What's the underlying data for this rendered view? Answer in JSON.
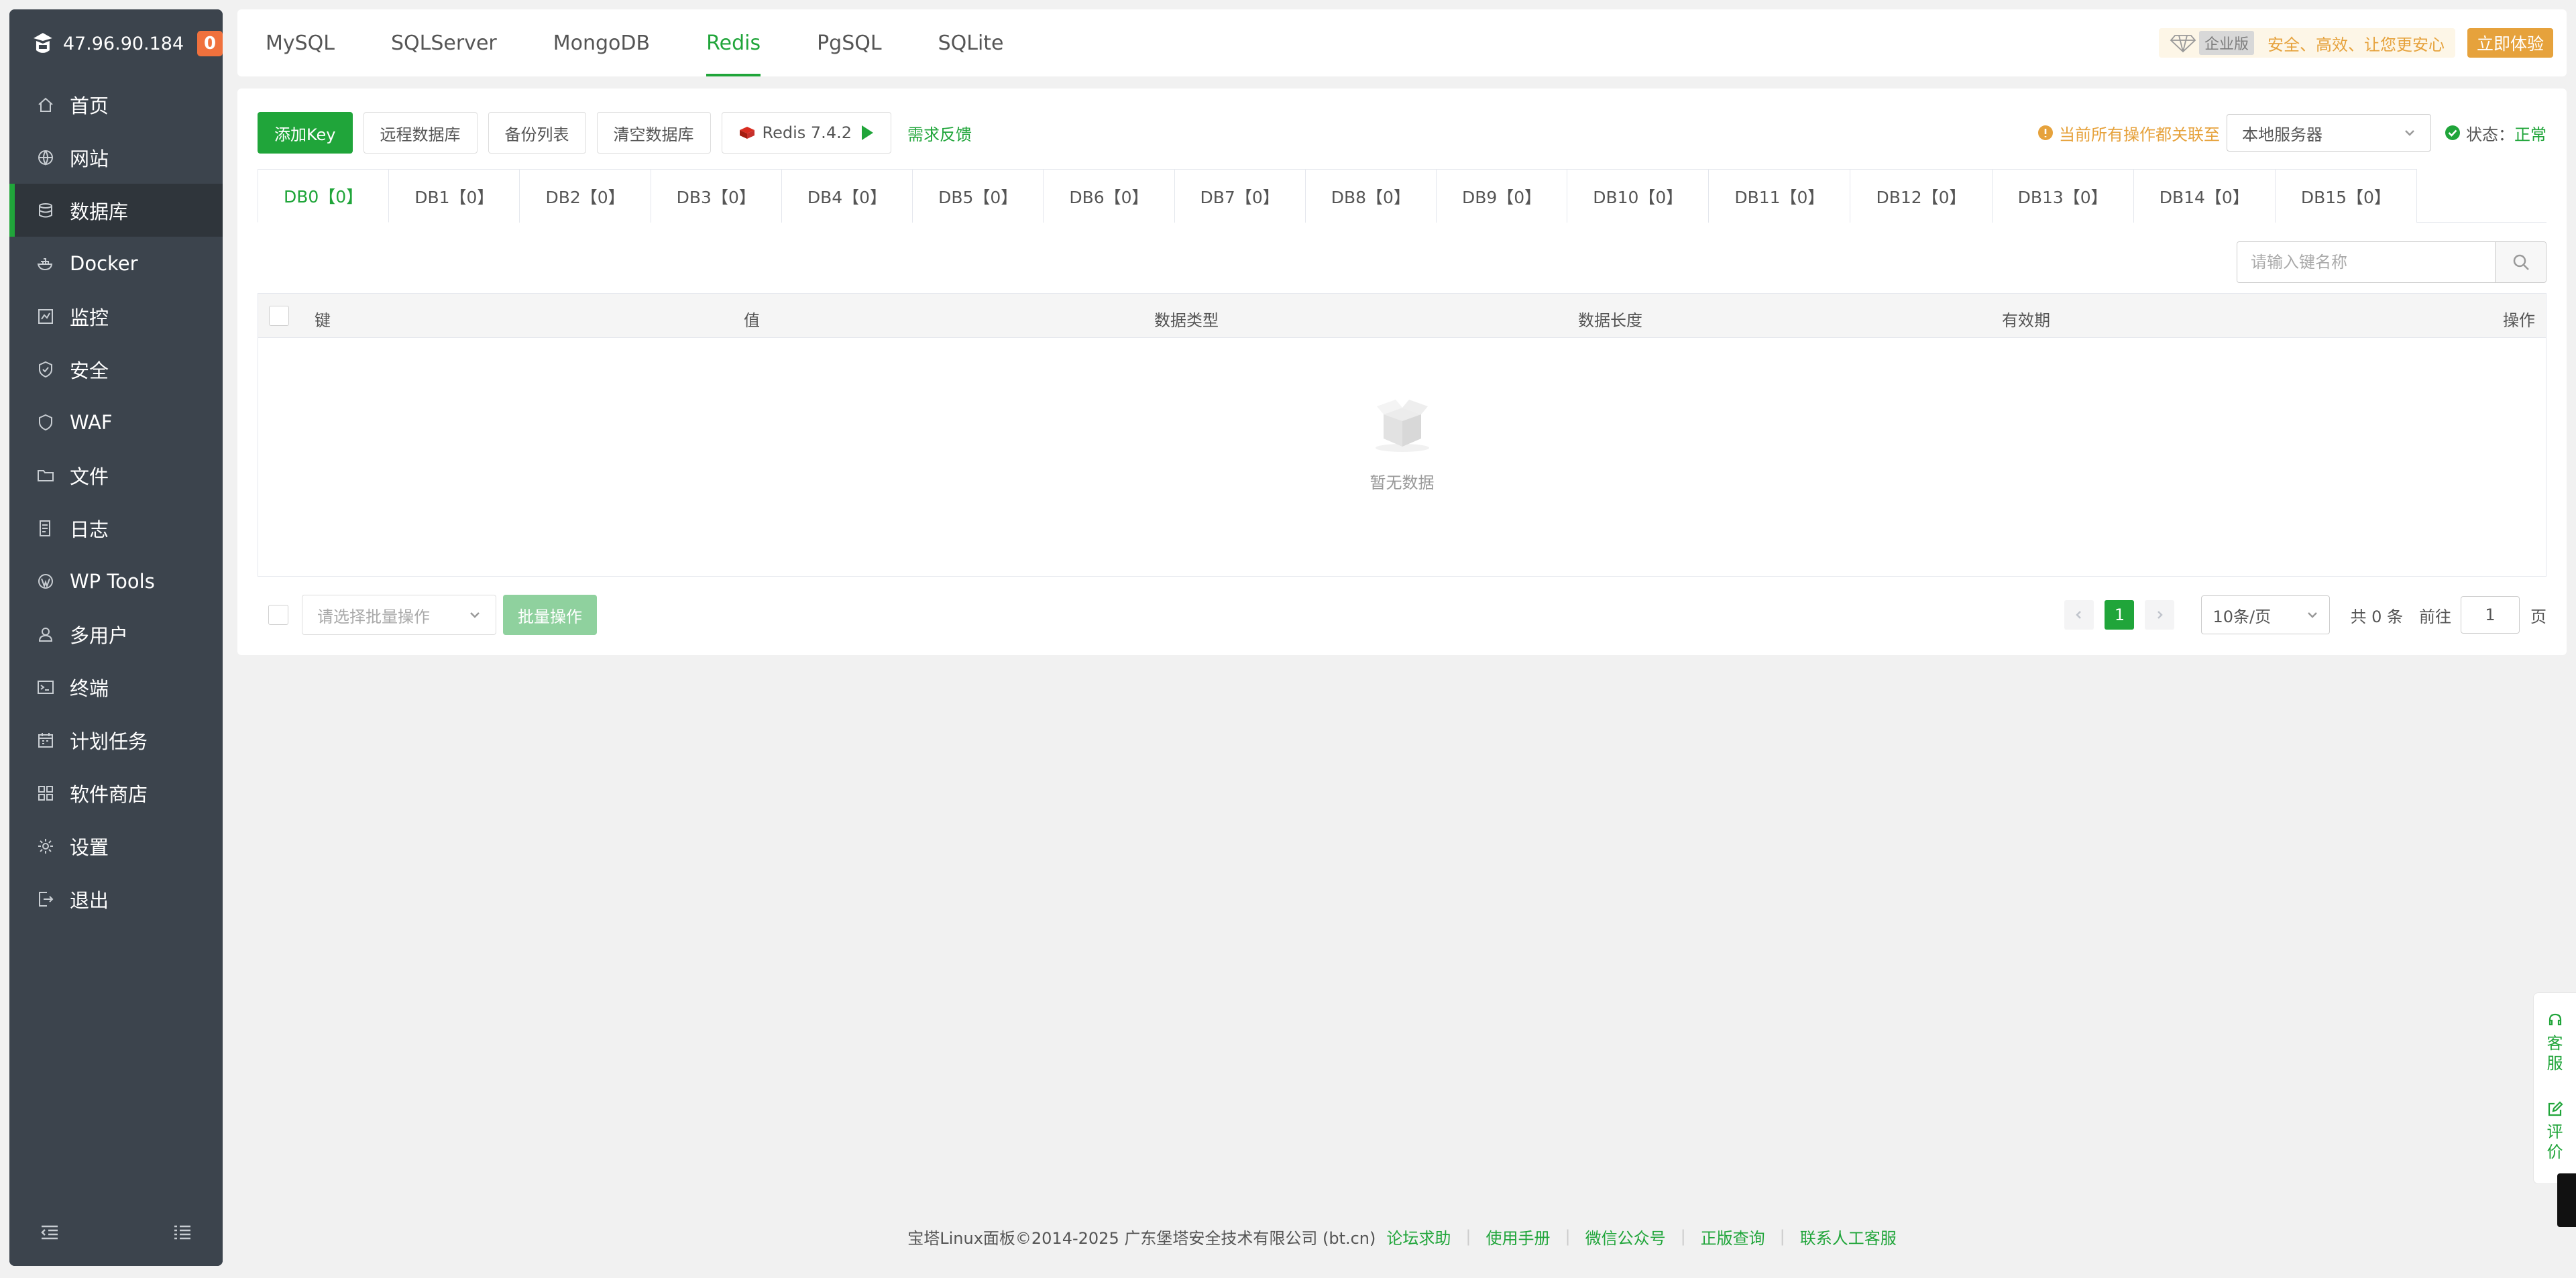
{
  "sidebar": {
    "ip": "47.96.90.184",
    "badge": "0",
    "items": [
      {
        "label": "首页",
        "icon": "home-icon"
      },
      {
        "label": "网站",
        "icon": "globe-icon"
      },
      {
        "label": "数据库",
        "icon": "database-icon"
      },
      {
        "label": "Docker",
        "icon": "docker-icon"
      },
      {
        "label": "监控",
        "icon": "monitor-icon"
      },
      {
        "label": "安全",
        "icon": "shield-icon"
      },
      {
        "label": "WAF",
        "icon": "waf-icon"
      },
      {
        "label": "文件",
        "icon": "folder-icon"
      },
      {
        "label": "日志",
        "icon": "log-icon"
      },
      {
        "label": "WP Tools",
        "icon": "wordpress-icon"
      },
      {
        "label": "多用户",
        "icon": "users-icon"
      },
      {
        "label": "终端",
        "icon": "terminal-icon"
      },
      {
        "label": "计划任务",
        "icon": "calendar-icon"
      },
      {
        "label": "软件商店",
        "icon": "apps-icon"
      },
      {
        "label": "设置",
        "icon": "gear-icon"
      },
      {
        "label": "退出",
        "icon": "logout-icon"
      }
    ],
    "active_index": 2
  },
  "topbar": {
    "tabs": [
      "MySQL",
      "SQLServer",
      "MongoDB",
      "Redis",
      "PgSQL",
      "SQLite"
    ],
    "active_index": 3,
    "promo": {
      "edition": "企业版",
      "slogan": "安全、高效、让您更安心",
      "cta": "立即体验"
    }
  },
  "toolbar": {
    "add_key": "添加Key",
    "remote_db": "远程数据库",
    "backup_list": "备份列表",
    "clear_db": "清空数据库",
    "redis_version": "Redis 7.4.2",
    "feedback": "需求反馈",
    "notice": "当前所有操作都关联至",
    "server": "本地服务器",
    "status_label": "状态：",
    "status_value": "正常"
  },
  "db_tabs": [
    "DB0【0】",
    "DB1【0】",
    "DB2【0】",
    "DB3【0】",
    "DB4【0】",
    "DB5【0】",
    "DB6【0】",
    "DB7【0】",
    "DB8【0】",
    "DB9【0】",
    "DB10【0】",
    "DB11【0】",
    "DB12【0】",
    "DB13【0】",
    "DB14【0】",
    "DB15【0】"
  ],
  "db_active_index": 0,
  "search": {
    "placeholder": "请输入键名称"
  },
  "table": {
    "columns": [
      "键",
      "值",
      "数据类型",
      "数据长度",
      "有效期",
      "操作"
    ],
    "empty_text": "暂无数据"
  },
  "bottom": {
    "batch_placeholder": "请选择批量操作",
    "batch_button": "批量操作",
    "current_page": "1",
    "page_size": "10条/页",
    "total": "共 0 条",
    "goto": "前往",
    "goto_value": "1",
    "page_unit": "页"
  },
  "footer": {
    "copyright": "宝塔Linux面板©2014-2025 广东堡塔安全技术有限公司 (bt.cn)",
    "links": [
      "论坛求助",
      "使用手册",
      "微信公众号",
      "正版查询",
      "联系人工客服"
    ]
  },
  "float": {
    "service": [
      "客",
      "服"
    ],
    "review": [
      "评",
      "价"
    ]
  },
  "colors": {
    "brand": "#20a53a",
    "sidebar": "#3c444d",
    "warning": "#e6a23c"
  }
}
